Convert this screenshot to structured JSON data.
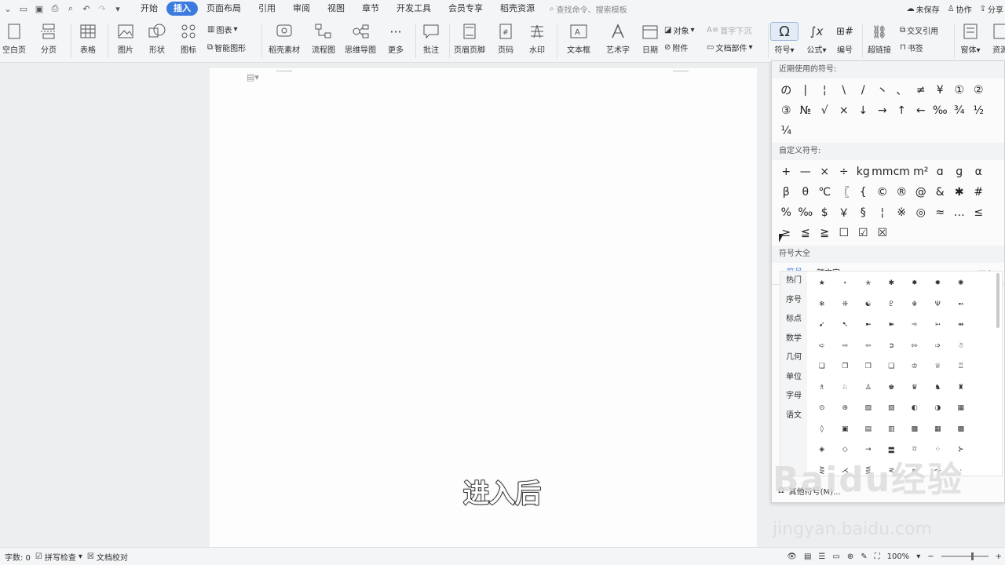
{
  "menubar": {
    "items": [
      "开始",
      "插入",
      "页面布局",
      "引用",
      "审阅",
      "视图",
      "章节",
      "开发工具",
      "会员专享",
      "稻壳资源"
    ],
    "active_index": 1,
    "search_placeholder": "查找命令、搜索模板",
    "right": {
      "unsaved": "未保存",
      "collab": "协作",
      "share": "分享"
    }
  },
  "ribbon": {
    "blank_page": "空白页",
    "page_break": "分页",
    "table": "表格",
    "picture": "图片",
    "shape": "形状",
    "icon": "图标",
    "chart": "图表",
    "smart_art": "智能图形",
    "docer_material": "稻壳素材",
    "flowchart": "流程图",
    "mindmap": "思维导图",
    "more": "更多",
    "comment": "批注",
    "header_footer": "页眉页脚",
    "page_number": "页码",
    "watermark": "水印",
    "textbox": "文本框",
    "wordart": "艺术字",
    "date": "日期",
    "object": "对象",
    "attachment": "附件",
    "drop_cap": "首字下沉",
    "doc_part": "文档部件",
    "symbol": "符号",
    "formula": "公式",
    "numbering": "编号",
    "hyperlink": "超链接",
    "cross_ref": "交叉引用",
    "bookmark": "书签",
    "form": "窗体",
    "resource": "资源"
  },
  "symbol_panel": {
    "recent_header": "近期使用的符号:",
    "recent": [
      "の",
      "|",
      "¦",
      "\\",
      "/",
      "丶",
      "、",
      "≠",
      "¥",
      "①",
      "②",
      "③",
      "№",
      "√",
      "×",
      "↓",
      "→",
      "↑",
      "←",
      "‰",
      "¾",
      "½",
      "¼"
    ],
    "custom_header": "自定义符号:",
    "custom": [
      "+",
      "—",
      "×",
      "÷",
      "kg",
      "mm",
      "cm",
      "m²",
      "ɑ",
      "ɡ",
      "α",
      "β",
      "θ",
      "℃",
      "〖",
      "{",
      "©",
      "®",
      "@",
      "&",
      "✱",
      "#",
      "%",
      "‰",
      "$",
      "￥",
      "§",
      "¦",
      "※",
      "◎",
      "≈",
      "…",
      "≤",
      "≥",
      "≦",
      "≧",
      "☐",
      "☑",
      "☒"
    ],
    "big_header": "符号大全",
    "tabs": [
      "符号",
      "颜文字"
    ],
    "more": "更多",
    "categories": [
      "热门",
      "序号",
      "标点",
      "数学",
      "几何",
      "单位",
      "字母",
      "语文"
    ],
    "grid": [
      "★",
      "⋆",
      "✭",
      "✱",
      "✸",
      "✹",
      "✺",
      "❄",
      "❊",
      "☯",
      "♇",
      "☬",
      "Ψ",
      "➻",
      "➹",
      "➷",
      "➼",
      "➽",
      "➾",
      "➳",
      "⇴",
      "➪",
      "⇨",
      "⇦",
      "➲",
      "⇰",
      "➩",
      "☃",
      "❏",
      "❐",
      "❒",
      "❑",
      "♔",
      "♕",
      "♖",
      "♗",
      "♘",
      "♙",
      "♚",
      "♛",
      "♞",
      "♜",
      "⊙",
      "⊛",
      "▧",
      "▨",
      "◐",
      "◑",
      "▦",
      "◊",
      "▣",
      "▤",
      "▥",
      "▩",
      "▦",
      "▩",
      "◈",
      "◇",
      "→",
      "〓",
      "⌑",
      "⁘",
      "⊱",
      "⋛",
      "⋌",
      "⋚",
      "⋜",
      "≈",
      "～",
      "·",
      "◕",
      "‿",
      "⋏",
      "⋎",
      "∵",
      "∴",
      "⊶",
      "⊷",
      "♩",
      "♪"
    ],
    "footer": "其他符号(M)..."
  },
  "caption": "进入后",
  "statusbar": {
    "word_count": "字数: 0",
    "spell_check": "拼写检查",
    "doc_proof": "文档校对",
    "zoom": "100%"
  },
  "watermark": {
    "brand": "Baidu经验",
    "url": "jingyan.baidu.com"
  }
}
